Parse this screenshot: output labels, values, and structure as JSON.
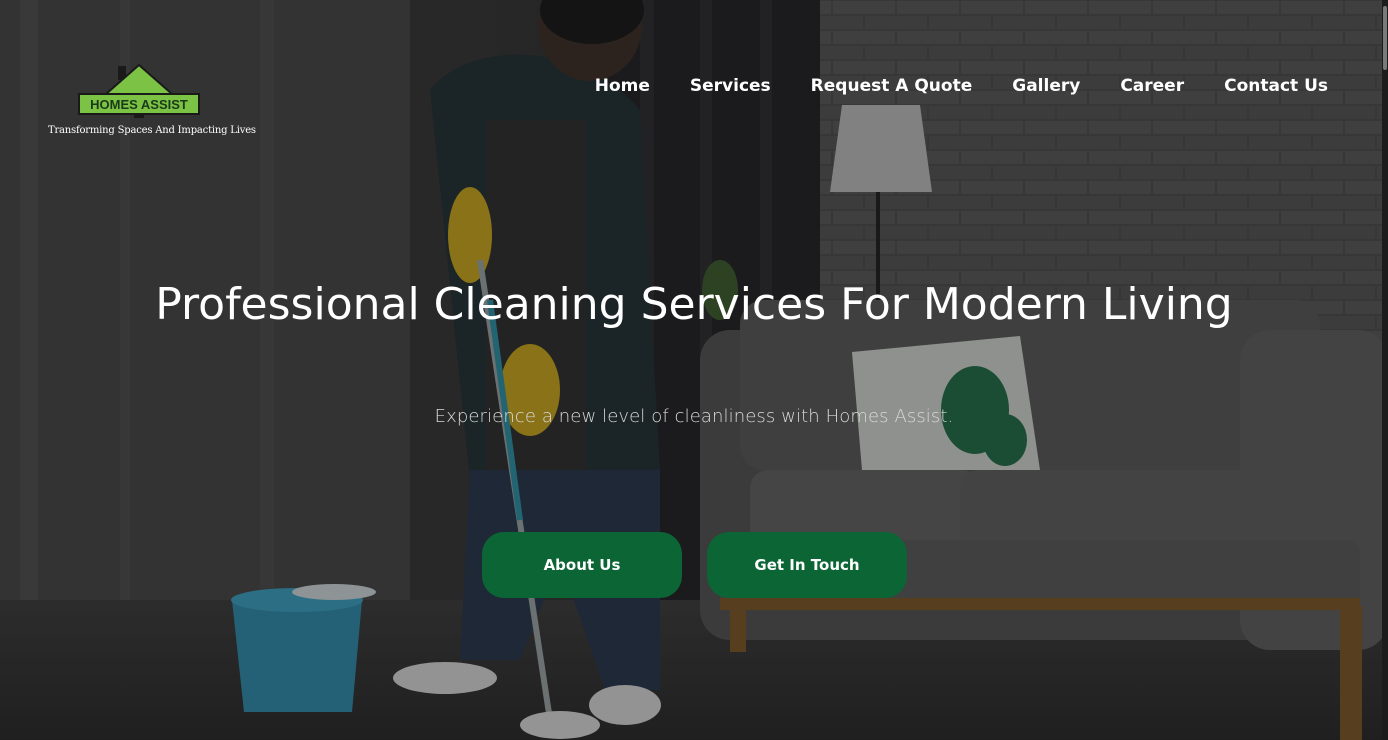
{
  "brand": {
    "logo_text": "HOMES ASSIST",
    "tagline": "Transforming Spaces And Impacting Lives",
    "logo_green": "#7cc244"
  },
  "nav": {
    "items": [
      {
        "label": "Home"
      },
      {
        "label": "Services"
      },
      {
        "label": "Request A Quote"
      },
      {
        "label": "Gallery"
      },
      {
        "label": "Career"
      },
      {
        "label": "Contact Us"
      }
    ]
  },
  "hero": {
    "title": "Professional Cleaning Services For Modern Living",
    "subtitle": "Experience a new level of cleanliness with Homes Assist.",
    "buttons": {
      "about_label": "About Us",
      "touch_label": "Get In Touch"
    },
    "button_color": "#0b6535"
  }
}
